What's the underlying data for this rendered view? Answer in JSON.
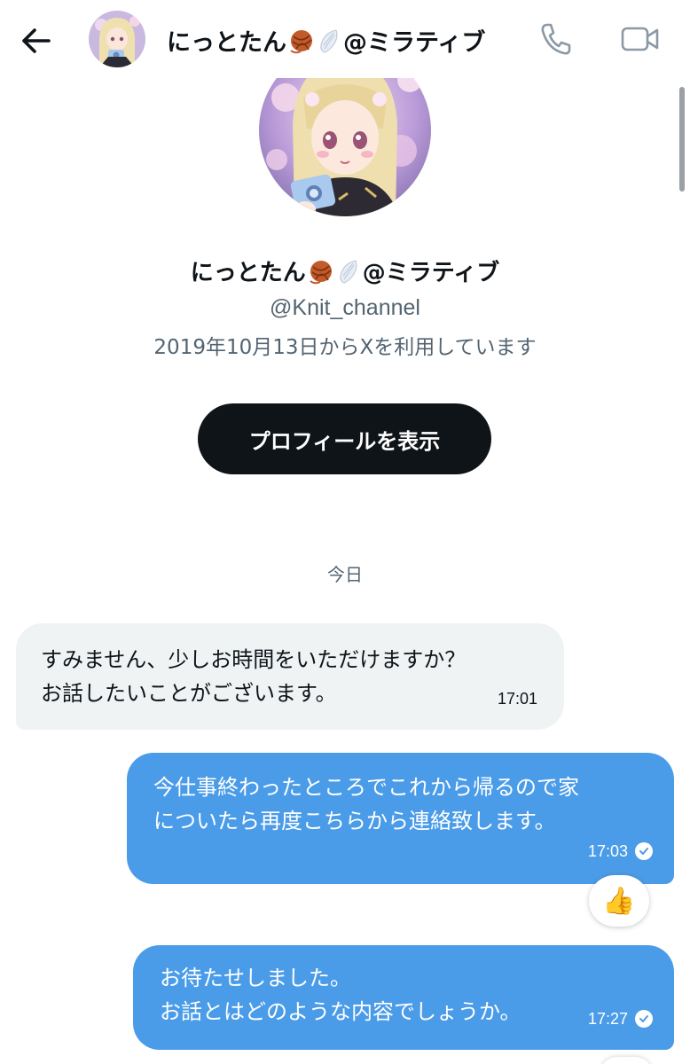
{
  "header": {
    "name": "にっとたん",
    "name_suffix": "@ミラティブ",
    "back_icon": "arrow-left-icon",
    "call_icon": "phone-icon",
    "video_icon": "video-camera-icon"
  },
  "profile": {
    "name": "にっとたん",
    "name_suffix": "@ミラティブ",
    "handle": "@Knit_channel",
    "joined": "2019年10月13日からXを利用しています",
    "view_profile_label": "プロフィールを表示"
  },
  "conversation": {
    "day_label": "今日",
    "messages": [
      {
        "direction": "incoming",
        "lines": [
          "すみません、少しお時間をいただけますか？",
          "お話したいことがございます。"
        ],
        "time": "17:01"
      },
      {
        "direction": "outgoing",
        "lines": [
          "今仕事終わったところでこれから帰るので家",
          "についたら再度こちらから連絡致します。"
        ],
        "time": "17:03",
        "reaction": "👍"
      },
      {
        "direction": "outgoing",
        "lines": [
          "お待たせしました。",
          "お話とはどのような内容でしょうか。"
        ],
        "time": "17:27"
      }
    ]
  },
  "colors": {
    "outgoing_bubble": "#4b9ce8",
    "incoming_bubble": "#eff3f4",
    "primary_button": "#0f1419",
    "secondary_text": "#536471"
  }
}
